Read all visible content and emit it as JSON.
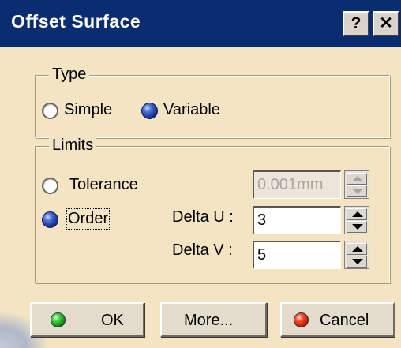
{
  "window": {
    "title": "Offset Surface",
    "help_label": "?",
    "close_label": "✕"
  },
  "type_group": {
    "legend": "Type",
    "options": [
      {
        "label": "Simple",
        "selected": false
      },
      {
        "label": "Variable",
        "selected": true
      }
    ]
  },
  "limits_group": {
    "legend": "Limits",
    "tolerance": {
      "label": "Tolerance",
      "selected": false,
      "value": "0.001mm",
      "enabled": false
    },
    "order": {
      "label": "Order",
      "selected": true
    },
    "delta_u": {
      "label": "Delta U :",
      "value": "3"
    },
    "delta_v": {
      "label": "Delta V :",
      "value": "5"
    }
  },
  "buttons": {
    "ok": "OK",
    "more": "More...",
    "cancel": "Cancel"
  },
  "colors": {
    "titlebar": "#0a2d72",
    "dialog_bg": "#f3e4c4",
    "ok_led": "#3ed13e",
    "cancel_led": "#ff4a2a"
  }
}
